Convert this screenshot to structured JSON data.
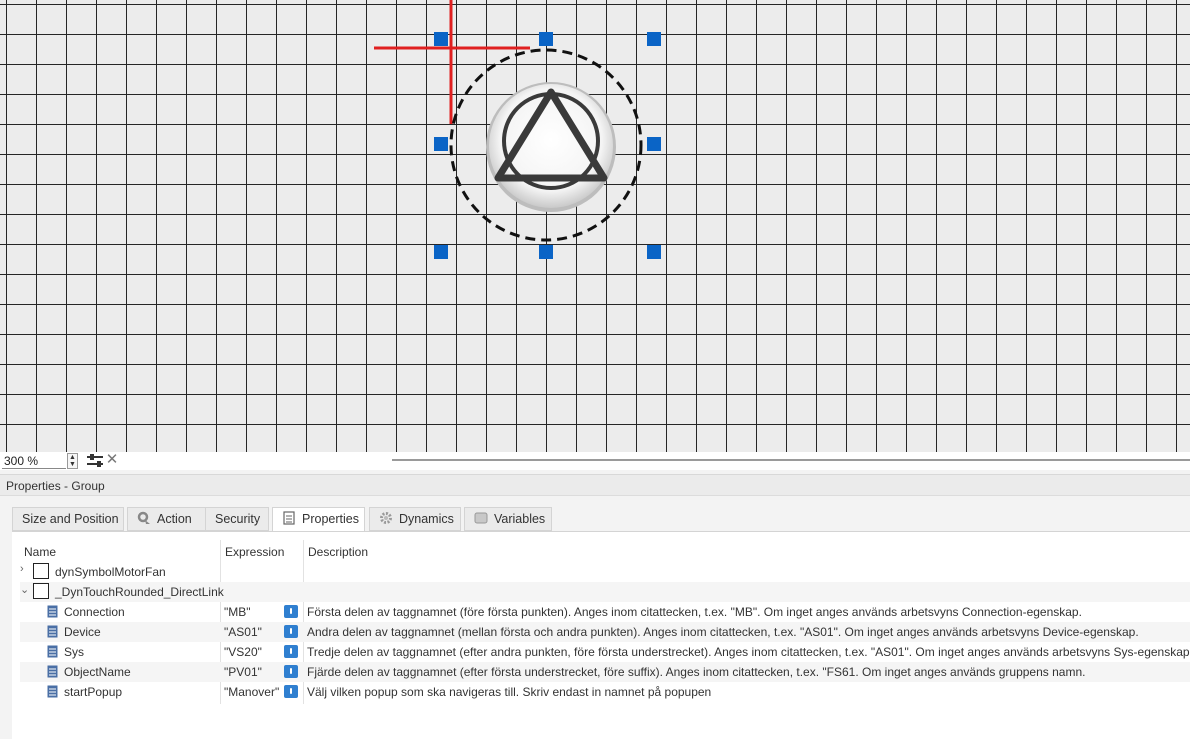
{
  "zoom": {
    "value": "300 %"
  },
  "colors": {
    "accent": "#0063b1",
    "handle": "#0a64c6",
    "crosshair": "#e02020",
    "info": "#2f7fd0"
  },
  "panel": {
    "title": "Properties - Group",
    "tabs": [
      {
        "label": "Size and Position",
        "icon": "none",
        "active": false
      },
      {
        "label": "Action",
        "icon": "gear-arrow-icon",
        "active": false
      },
      {
        "label": "Security",
        "icon": "none",
        "active": false
      },
      {
        "label": "Properties",
        "icon": "document-icon",
        "active": true
      },
      {
        "label": "Dynamics",
        "icon": "gear-icon",
        "active": false
      },
      {
        "label": "Variables",
        "icon": "table-icon",
        "active": false
      }
    ],
    "columns": {
      "name": "Name",
      "expression": "Expression",
      "description": "Description"
    },
    "groups": [
      {
        "name": "dynSymbolMotorFan",
        "expanded": false
      },
      {
        "name": "_DynTouchRounded_DirectLink",
        "expanded": true
      }
    ],
    "rows": [
      {
        "name": "Connection",
        "expression": "\"MB\"",
        "description": "Första delen av taggnamnet (före första punkten). Anges inom citattecken, t.ex. \"MB\". Om inget anges används arbetsvyns Connection-egenskap."
      },
      {
        "name": "Device",
        "expression": "\"AS01\"",
        "description": "Andra delen av taggnamnet (mellan första och andra punkten). Anges inom citattecken, t.ex. \"AS01\". Om inget anges används arbetsvyns Device-egenskap."
      },
      {
        "name": "Sys",
        "expression": "\"VS20\"",
        "description": "Tredje delen av taggnamnet (efter andra punkten, före första understrecket). Anges inom citattecken, t.ex. \"AS01\". Om inget anges används arbetsvyns Sys-egenskap."
      },
      {
        "name": "ObjectName",
        "expression": "\"PV01\"",
        "description": "Fjärde delen av taggnamnet (efter första understrecket, före suffix). Anges inom citattecken, t.ex. \"FS61. Om inget anges används gruppens namn."
      },
      {
        "name": "startPopup",
        "expression": "\"Manover\"",
        "description": "Välj vilken popup som ska navigeras till. Skriv endast in namnet på popupen"
      }
    ]
  }
}
